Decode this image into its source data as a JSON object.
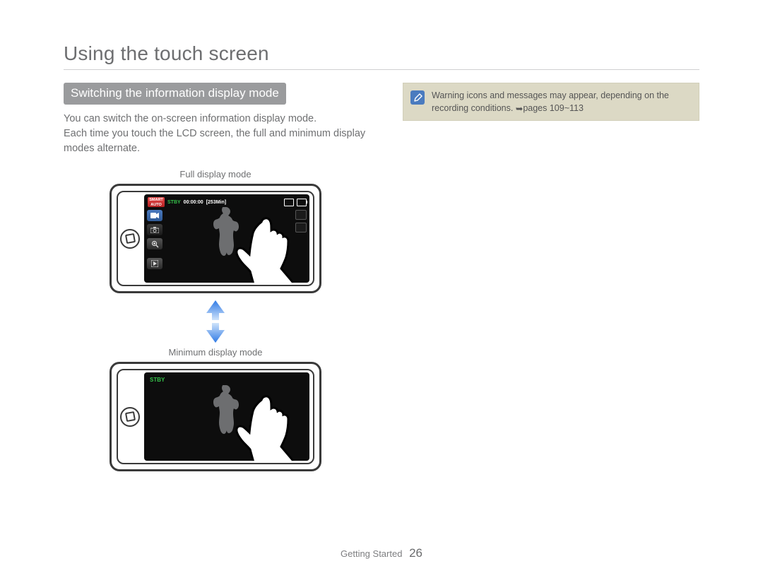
{
  "title": "Using the touch screen",
  "subhead": "Switching the information display mode",
  "body": "You can switch the on-screen information display mode.\nEach time you touch the LCD screen, the full and minimum display modes alternate.",
  "captions": {
    "full": "Full display mode",
    "min": "Minimum display mode"
  },
  "hud": {
    "smart_label_line1": "SMART",
    "smart_label_line2": "AUTO",
    "stby": "STBY",
    "timecode": "00:00:00",
    "remaining": "[253Min]"
  },
  "note": {
    "text": "Warning icons and messages may appear, depending on the recording conditions. ",
    "arrow_glyph": "➥",
    "ref": "pages 109~113"
  },
  "footer": {
    "section": "Getting Started",
    "page": "26"
  }
}
